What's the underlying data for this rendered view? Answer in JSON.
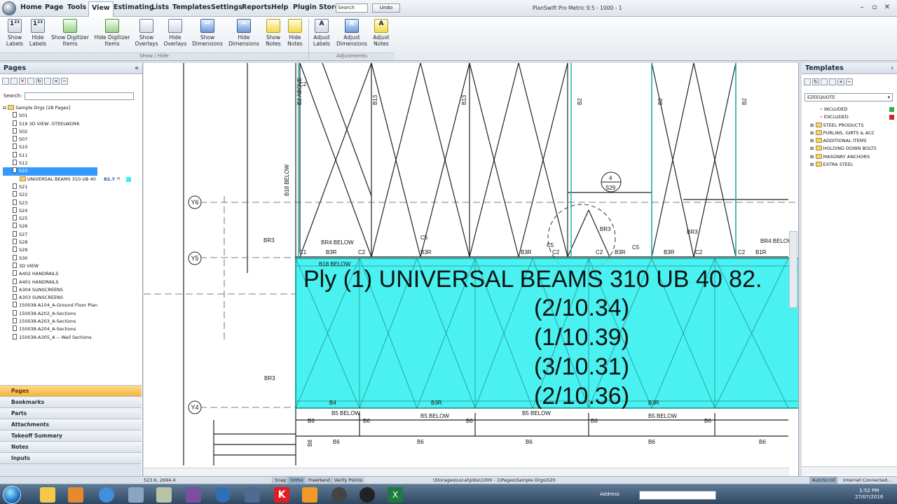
{
  "app": {
    "window_title": "PlanSwift Pro Metric 9.5 - 1000 - 1",
    "menu": [
      "Home",
      "Page",
      "Tools",
      "View",
      "Estimating",
      "Lists",
      "Templates",
      "Settings",
      "Reports",
      "Help",
      "Plugin Store"
    ],
    "active_menu": "View",
    "search_placeholder": "Search",
    "undo_label": "Undo"
  },
  "ribbon": {
    "buttons": [
      {
        "line1": "Show",
        "line2": "Labels",
        "icon": "show-labels-icon"
      },
      {
        "line1": "Hide",
        "line2": "Labels",
        "icon": "hide-labels-icon"
      },
      {
        "line1": "Show Digitizer",
        "line2": "Items",
        "icon": "show-digitizer-icon"
      },
      {
        "line1": "Hide Digitizer",
        "line2": "Items",
        "icon": "hide-digitizer-icon"
      },
      {
        "line1": "Show",
        "line2": "Overlays",
        "icon": "show-overlays-icon"
      },
      {
        "line1": "Hide",
        "line2": "Overlays",
        "icon": "hide-overlays-icon"
      },
      {
        "line1": "Show",
        "line2": "Dimensions",
        "icon": "show-dimensions-icon"
      },
      {
        "line1": "Hide",
        "line2": "Dimensions",
        "icon": "hide-dimensions-icon"
      },
      {
        "line1": "Show",
        "line2": "Notes",
        "icon": "show-notes-icon"
      },
      {
        "line1": "Hide",
        "line2": "Notes",
        "icon": "hide-notes-icon"
      },
      {
        "line1": "Adjust",
        "line2": "Labels",
        "icon": "adjust-labels-icon"
      },
      {
        "line1": "Adjust",
        "line2": "Dimensions",
        "icon": "adjust-dimensions-icon"
      },
      {
        "line1": "Adjust",
        "line2": "Notes",
        "icon": "adjust-notes-icon"
      }
    ],
    "groups": [
      "Show / Hide",
      "Adjustments"
    ]
  },
  "pages_panel": {
    "title": "Pages",
    "search_label": "Search:",
    "root": "Sample Drgs [28 Pages]",
    "items": [
      "S01",
      "S19 3D VIEW -STEELWORK",
      "S02",
      "S07",
      "S10",
      "S11",
      "S12",
      "S20",
      "UNIVERSAL BEAMS 310 UB 40",
      "S21",
      "S22",
      "S23",
      "S24",
      "S25",
      "S26",
      "S27",
      "S28",
      "S29",
      "S30",
      "3D VIEW",
      "A402 HANDRAILS",
      "A401 HANDRAILS",
      "A304 SUNSCREENS",
      "A303 SUNSCREENS",
      "150038-A104_A-Ground Floor Plan",
      "150038-A202_A-Sections",
      "150038-A203_A-Sections",
      "150038-A204_A-Sections",
      "150038-A305_A -- Wall Sections"
    ],
    "selected": "S20",
    "takeoff_value": "82.7",
    "takeoff_unit": "M"
  },
  "nav": [
    "Pages",
    "Bookmarks",
    "Parts",
    "Attachments",
    "Takeoff Summary",
    "Notes",
    "Inputs"
  ],
  "drawing": {
    "overlay_lines": [
      "Ply (1) UNIVERSAL BEAMS 310 UB 40 82.",
      "(2/10.34)",
      "(1/10.39)",
      "(3/10.31)",
      "(2/10.36)"
    ],
    "grid_labels": [
      "Y6",
      "Y5",
      "Y4"
    ],
    "labels": [
      "B2 ABOVE",
      "C2",
      "B13",
      "B13",
      "B2",
      "B2",
      "B2",
      "B18 BELOW",
      "4",
      "S29",
      "BR3",
      "BR3",
      "BR3",
      "BR4 BELOW",
      "BR4 BELOW",
      "C5",
      "C5",
      "C5",
      "B3R",
      "B3R",
      "B3R",
      "B3R",
      "B1R",
      "B3R",
      "C1",
      "C2",
      "C2",
      "C2",
      "C2",
      "C2",
      "BR3",
      "B6",
      "B6",
      "B6",
      "B6",
      "B6",
      "B6",
      "B6",
      "B6",
      "B6",
      "B6",
      "B6",
      "B5 BELOW",
      "B5 BELOW",
      "B5 BELOW",
      "B5 BELOW",
      "B4",
      "B3R",
      "B3R",
      "B18 BELOW",
      "B8"
    ]
  },
  "templates_panel": {
    "title": "Templates",
    "dropdown": "EZEEQUOTE",
    "items": [
      {
        "label": "INCLUDED",
        "color": "#2bb24c"
      },
      {
        "label": "EXCLUDED",
        "color": "#d42020"
      },
      {
        "label": "STEEL PRODUCTS"
      },
      {
        "label": "PURLINS, GIRTS & ACC"
      },
      {
        "label": "ADDITIONAL ITEMS"
      },
      {
        "label": "HOLDING DOWN BOLTS"
      },
      {
        "label": "MASONRY ANCHORS"
      },
      {
        "label": "EXTRA STEEL"
      }
    ]
  },
  "status": {
    "coords": "523.6, 2694.4",
    "buttons": [
      "Snap",
      "Ortho",
      "FreeHand",
      "Verify Points"
    ],
    "path": "\\Storages\\Local\\Jobs\\1000 - 1\\Pages\\Sample Drgs\\S20",
    "autoscroll": "AutoScroll",
    "connection": "Internet Connected..."
  },
  "taskbar": {
    "address_label": "Address",
    "time": "1:52 PM",
    "date": "27/07/2016"
  },
  "colors": {
    "overlay": "#35f0ee",
    "selection": "#3399ff",
    "active_nav": "#f5b43d"
  }
}
